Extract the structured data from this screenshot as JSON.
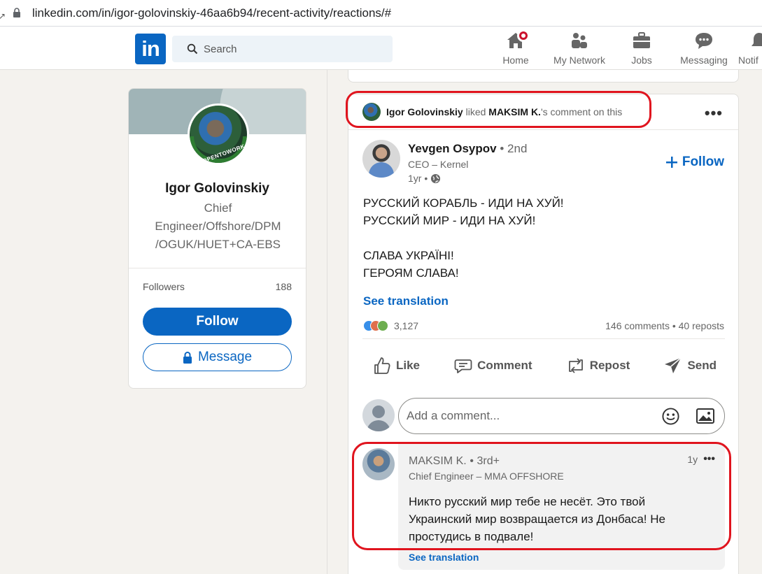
{
  "browser": {
    "url": "linkedin.com/in/igor-golovinskiy-46aa6b94/recent-activity/reactions/#"
  },
  "nav": {
    "logo": "in",
    "search_placeholder": "Search",
    "items": [
      {
        "label": "Home",
        "icon": "home-icon"
      },
      {
        "label": "My Network",
        "icon": "network-icon"
      },
      {
        "label": "Jobs",
        "icon": "briefcase-icon"
      },
      {
        "label": "Messaging",
        "icon": "messaging-icon"
      },
      {
        "label": "Notif",
        "icon": "bell-icon"
      }
    ]
  },
  "profile": {
    "name": "Igor Golovinskiy",
    "headline_lines": [
      "Chief",
      "Engineer/Offshore/DPM",
      "/OGUK/HUET+CA-EBS"
    ],
    "avatar_badge": "#OPENTOWORK",
    "followers_label": "Followers",
    "followers_count": "188",
    "follow_label": "Follow",
    "message_label": "Message"
  },
  "post": {
    "activity": {
      "actor": "Igor Golovinskiy",
      "verb": "liked",
      "target": "MAKSIM K.",
      "suffix": "'s comment on this"
    },
    "author": {
      "name": "Yevgen Osypov",
      "degree": "• 2nd",
      "title": "CEO – Kernel",
      "time": "1yr •"
    },
    "follow_label": "Follow",
    "text_lines": [
      "РУССКИЙ КОРАБЛЬ - ИДИ НА ХУЙ!",
      "РУССКИЙ МИР - ИДИ НА ХУЙ!",
      "",
      "СЛАВА УКРАЇНІ!",
      "ГЕРОЯМ СЛАВА!"
    ],
    "see_translation": "See translation",
    "reactions_count": "3,127",
    "comments_reposts": "146 comments • 40 reposts",
    "actions": [
      {
        "label": "Like",
        "icon": "like-icon"
      },
      {
        "label": "Comment",
        "icon": "comment-icon"
      },
      {
        "label": "Repost",
        "icon": "repost-icon"
      },
      {
        "label": "Send",
        "icon": "send-icon"
      }
    ],
    "comment_placeholder": "Add a comment...",
    "comment": {
      "name": "MAKSIM K.",
      "degree": "• 3rd+",
      "title": "Chief Engineer – MMA OFFSHORE",
      "time": "1y",
      "text": "Никто русский мир тебе не несёт. Это твой Украинский мир возвращается из Донбаса! Не простудись в подвале!",
      "see_translation": "See translation"
    }
  },
  "colors": {
    "brand": "#0a66c2",
    "highlight": "#e0141e",
    "notification": "#cb112d"
  }
}
